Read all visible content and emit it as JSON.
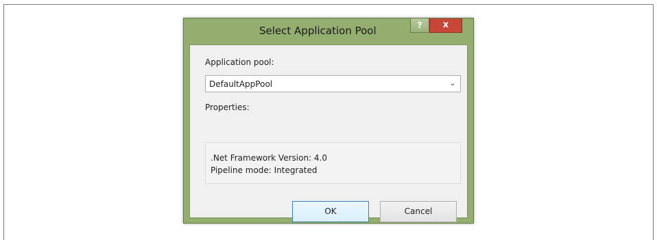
{
  "dialog": {
    "title": "Select Application Pool",
    "help_glyph": "?",
    "close_glyph": "x"
  },
  "application_pool": {
    "label": "Application pool:",
    "selected_value": "DefaultAppPool",
    "dropdown_glyph": "⌄"
  },
  "properties": {
    "label": "Properties:",
    "framework_version": ".Net Framework Version: 4.0",
    "pipeline_mode": "Pipeline mode: Integrated"
  },
  "buttons": {
    "ok_label": "OK",
    "cancel_label": "Cancel"
  },
  "colors": {
    "window_frame": "#94ae6f",
    "close_button": "#c74637",
    "client_background": "#f0f0f0"
  }
}
